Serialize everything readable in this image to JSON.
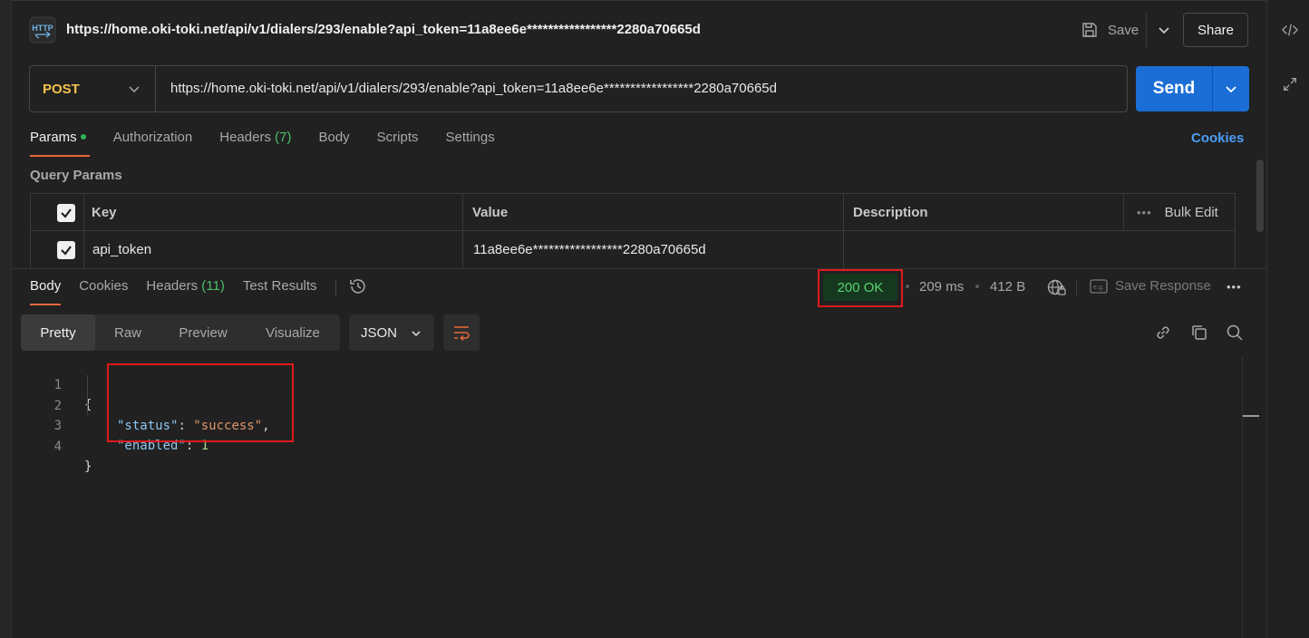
{
  "request": {
    "title": "https://home.oki-toki.net/api/v1/dialers/293/enable?api_token=11a8ee6e*****************2280a70665d",
    "method": "POST",
    "url": "https://home.oki-toki.net/api/v1/dialers/293/enable?api_token=11a8ee6e*****************2280a70665d",
    "save_label": "Save",
    "share_label": "Share",
    "send_label": "Send"
  },
  "request_tabs": {
    "params": "Params",
    "authorization": "Authorization",
    "headers": "Headers",
    "headers_count": "(7)",
    "body": "Body",
    "scripts": "Scripts",
    "settings": "Settings",
    "cookies": "Cookies"
  },
  "query_params": {
    "section_title": "Query Params",
    "columns": {
      "key": "Key",
      "value": "Value",
      "description": "Description",
      "bulk_edit": "Bulk Edit"
    },
    "rows": [
      {
        "key": "api_token",
        "value": "11a8ee6e*****************2280a70665d",
        "description": ""
      }
    ]
  },
  "response_tabs": {
    "body": "Body",
    "cookies": "Cookies",
    "headers": "Headers",
    "headers_count": "(11)",
    "test_results": "Test Results"
  },
  "response_meta": {
    "status": "200 OK",
    "time": "209 ms",
    "size": "412 B",
    "save_response": "Save Response"
  },
  "body_view": {
    "modes": [
      "Pretty",
      "Raw",
      "Preview",
      "Visualize"
    ],
    "active_mode": "Pretty",
    "format": "JSON"
  },
  "code": {
    "line_numbers": [
      "1",
      "2",
      "3",
      "4"
    ],
    "open_brace": "{",
    "close_brace": "}",
    "status_key": "\"status\"",
    "status_value": "\"success\"",
    "enabled_key": "\"enabled\"",
    "enabled_value": "1"
  },
  "colors": {
    "accent": "#e8693a",
    "send": "#1b6ed6",
    "method": "#f5c24a",
    "status_ok": "#57d36f",
    "highlight_box": "#e0191b"
  },
  "icons": [
    "http-icon",
    "save-icon",
    "chevron-down-icon",
    "code-icon",
    "expand-icon",
    "check-icon",
    "history-icon",
    "globe-lock-icon",
    "example-icon",
    "more-icon",
    "wrap-icon",
    "link-icon",
    "copy-icon",
    "search-icon"
  ]
}
